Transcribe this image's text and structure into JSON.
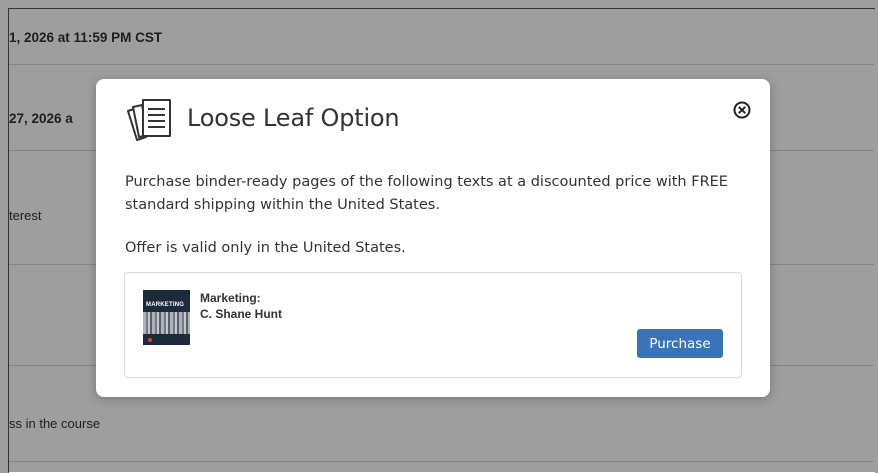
{
  "background": {
    "rows": [
      {
        "text": "1, 2026 at 11:59 PM CST"
      },
      {
        "text": "27, 2026 a"
      },
      {
        "text": "terest"
      },
      {
        "text": "ss in the course"
      }
    ]
  },
  "modal": {
    "title": "Loose Leaf Option",
    "icon": "loose-leaf-pages-icon",
    "close_icon": "close-circle-icon",
    "description": "Purchase binder-ready pages of the following texts at a discounted price with FREE standard shipping within the United States.",
    "offer_note": "Offer is valid only in the United States.",
    "product": {
      "cover_label": "MARKETING",
      "title": "Marketing:",
      "author": "C. Shane Hunt",
      "button_label": "Purchase"
    }
  },
  "colors": {
    "accent": "#3a73b8",
    "overlay": "rgba(0,0,0,0.38)"
  }
}
